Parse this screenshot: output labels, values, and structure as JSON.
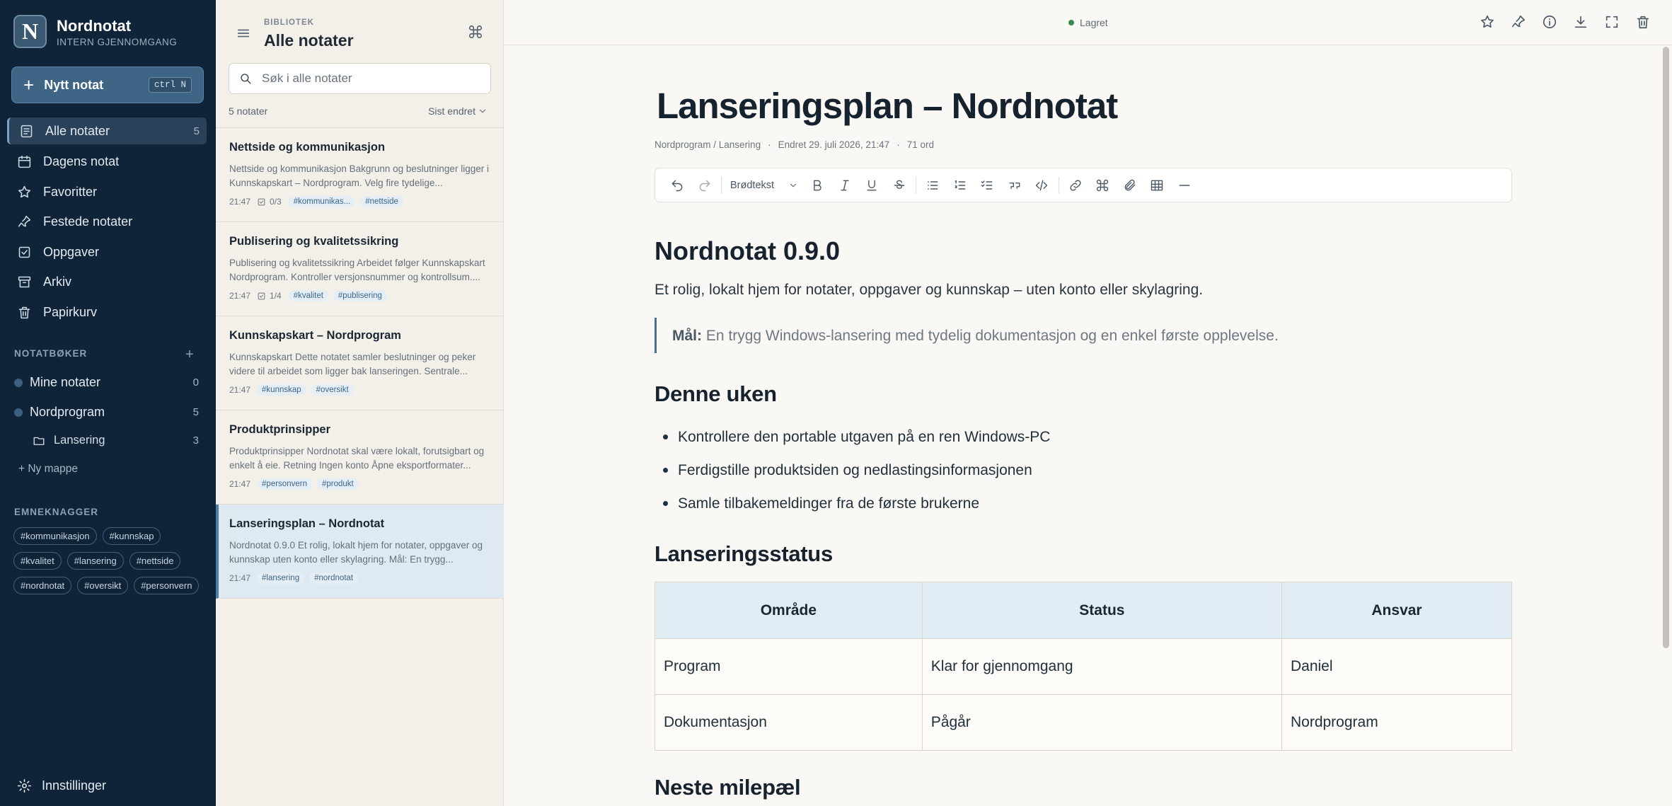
{
  "app": {
    "name": "Nordnotat",
    "subtitle": "INTERN GJENNOMGANG",
    "logo_letter": "N"
  },
  "sidebar": {
    "new_note": {
      "label": "Nytt notat",
      "shortcut": "ctrl N"
    },
    "nav": [
      {
        "label": "Alle notater",
        "count": "5",
        "icon": "notes-icon",
        "active": true
      },
      {
        "label": "Dagens notat",
        "icon": "calendar-icon"
      },
      {
        "label": "Favoritter",
        "icon": "star-icon"
      },
      {
        "label": "Festede notater",
        "icon": "pin-icon"
      },
      {
        "label": "Oppgaver",
        "icon": "checkbox-icon"
      },
      {
        "label": "Arkiv",
        "icon": "archive-icon"
      },
      {
        "label": "Papirkurv",
        "icon": "trash-icon"
      }
    ],
    "notebooks_heading": "NOTATBØKER",
    "notebooks": [
      {
        "label": "Mine notater",
        "count": "0"
      },
      {
        "label": "Nordprogram",
        "count": "5"
      }
    ],
    "folder": {
      "label": "Lansering",
      "count": "3"
    },
    "new_folder": "Ny mappe",
    "tags_heading": "EMNEKNAGGER",
    "tags": [
      "#kommunikasjon",
      "#kunnskap",
      "#kvalitet",
      "#lansering",
      "#nettside",
      "#nordnotat",
      "#oversikt",
      "#personvern"
    ],
    "settings": "Innstillinger"
  },
  "list": {
    "section_label": "BIBLIOTEK",
    "title": "Alle notater",
    "search_placeholder": "Søk i alle notater",
    "count_label": "5 notater",
    "sort_label": "Sist endret",
    "notes": [
      {
        "title": "Nettside og kommunikasjon",
        "preview": "Nettside og kommunikasjon Bakgrunn og beslutninger ligger i Kunnskapskart – Nordprogram. Velg fire tydelige...",
        "time": "21:47",
        "tasks": "0/3",
        "tags": [
          "#kommunikas...",
          "#nettside"
        ]
      },
      {
        "title": "Publisering og kvalitetssikring",
        "preview": "Publisering og kvalitetssikring Arbeidet følger Kunnskapskart Nordprogram. Kontroller versjonsnummer og kontrollsum....",
        "time": "21:47",
        "tasks": "1/4",
        "tags": [
          "#kvalitet",
          "#publisering"
        ]
      },
      {
        "title": "Kunnskapskart – Nordprogram",
        "preview": "Kunnskapskart Dette notatet samler beslutninger og peker videre til arbeidet som ligger bak lanseringen. Sentrale...",
        "time": "21:47",
        "tasks": "",
        "tags": [
          "#kunnskap",
          "#oversikt"
        ]
      },
      {
        "title": "Produktprinsipper",
        "preview": "Produktprinsipper Nordnotat skal være lokalt, forutsigbart og enkelt å eie. Retning Ingen konto Åpne eksportformater...",
        "time": "21:47",
        "tasks": "",
        "tags": [
          "#personvern",
          "#produkt"
        ]
      },
      {
        "title": "Lanseringsplan – Nordnotat",
        "preview": "Nordnotat 0.9.0 Et rolig, lokalt hjem for notater, oppgaver og kunnskap uten konto eller skylagring. Mål: En trygg...",
        "time": "21:47",
        "tasks": "",
        "tags": [
          "#lansering",
          "#nordnotat"
        ],
        "selected": true
      }
    ]
  },
  "editor": {
    "status": "Lagret",
    "title": "Lanseringsplan – Nordnotat",
    "meta": {
      "path": "Nordprogram / Lansering",
      "sep": "·",
      "edited": "Endret 29. juli 2026, 21:47",
      "words": "71 ord"
    },
    "block_type": "Brødtekst",
    "content": {
      "h1": "Nordnotat 0.9.0",
      "lead": "Et rolig, lokalt hjem for notater, oppgaver og kunnskap – uten konto eller skylagring.",
      "quote_label": "Mål:",
      "quote_text": "En trygg Windows-lansering med tydelig dokumentasjon og en enkel første opplevelse.",
      "h2_week": "Denne uken",
      "bullets": [
        "Kontrollere den portable utgaven på en ren Windows-PC",
        "Ferdigstille produktsiden og nedlastingsinformasjonen",
        "Samle tilbakemeldinger fra de første brukerne"
      ],
      "h2_status": "Lanseringsstatus",
      "table": {
        "headers": [
          "Område",
          "Status",
          "Ansvar"
        ],
        "rows": [
          [
            "Program",
            "Klar for gjennomgang",
            "Daniel"
          ],
          [
            "Dokumentasjon",
            "Pågår",
            "Nordprogram"
          ]
        ]
      },
      "h2_next": "Neste milepæl"
    }
  }
}
